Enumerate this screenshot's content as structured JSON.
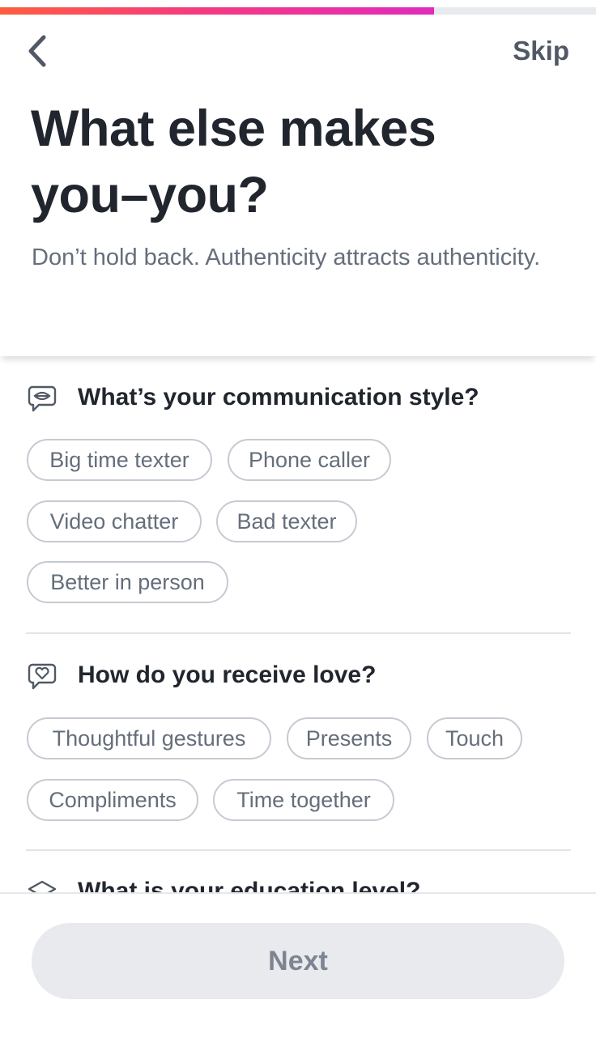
{
  "progress": {
    "fraction": 0.728
  },
  "nav": {
    "back_icon": "chevron-left-icon",
    "skip_label": "Skip"
  },
  "header": {
    "title_line1": "What else makes",
    "title_line2": "you–you?",
    "subtitle": "Don’t hold back. Authenticity attracts authenticity."
  },
  "sections": [
    {
      "icon": "speech-bubble-icon",
      "title": "What’s your communication style?",
      "options": [
        "Big time texter",
        "Phone caller",
        "Video chatter",
        "Bad texter",
        "Better in person"
      ]
    },
    {
      "icon": "heart-bubble-icon",
      "title": "How do you receive love?",
      "options": [
        "Thoughtful gestures",
        "Presents",
        "Touch",
        "Compliments",
        "Time together"
      ]
    },
    {
      "icon": "graduation-cap-icon",
      "title": "What is your education level?",
      "options": []
    }
  ],
  "footer": {
    "next_label": "Next"
  },
  "colors": {
    "gradient_start": "#fd5e3f",
    "gradient_mid": "#f43b7f",
    "gradient_end": "#e02bbd",
    "chip_border": "#c6cad2",
    "button_disabled_bg": "#e9eaee"
  }
}
